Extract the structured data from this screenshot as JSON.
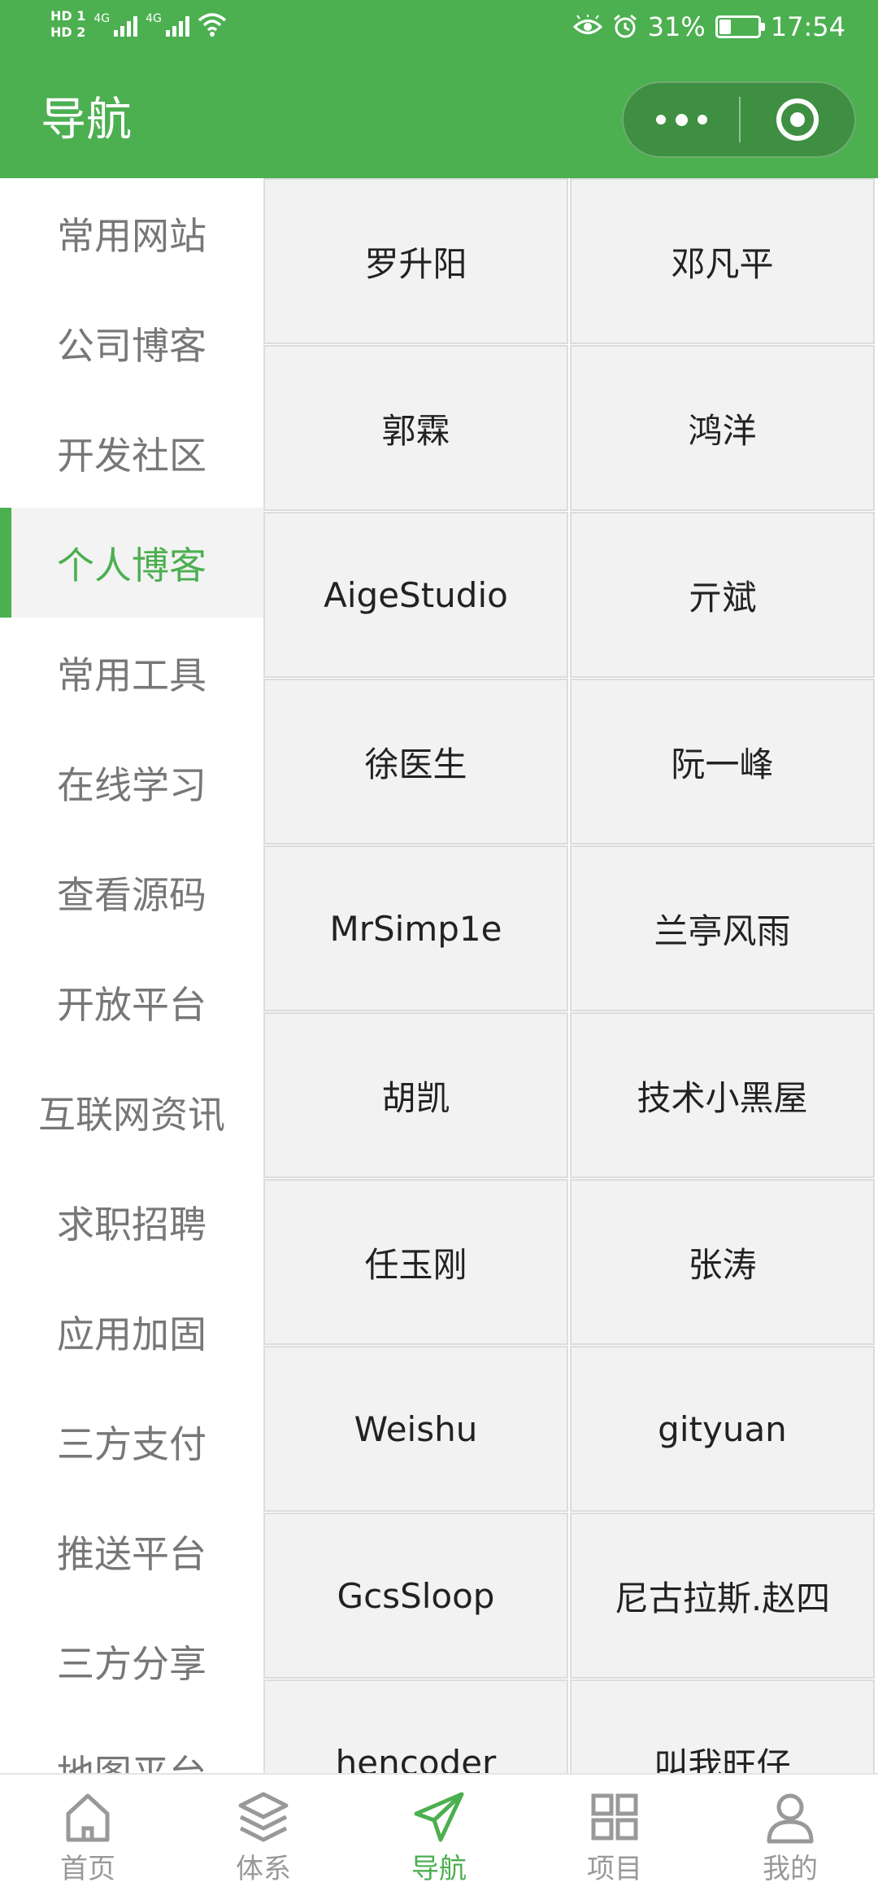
{
  "status_bar": {
    "hd_top": "HD 1",
    "hd_bottom": "HD 2",
    "signal_label": "4G",
    "battery_percent": "31%",
    "time": "17:54",
    "icons": [
      "eye-icon",
      "alarm-icon",
      "battery-icon",
      "wifi-icon",
      "signal-icon"
    ]
  },
  "header": {
    "title": "导航",
    "capsule": {
      "more_icon": "more-dots-icon",
      "close_icon": "target-close-icon"
    }
  },
  "sidebar": {
    "items": [
      {
        "label": "常用网站",
        "active": false
      },
      {
        "label": "公司博客",
        "active": false
      },
      {
        "label": "开发社区",
        "active": false
      },
      {
        "label": "个人博客",
        "active": true
      },
      {
        "label": "常用工具",
        "active": false
      },
      {
        "label": "在线学习",
        "active": false
      },
      {
        "label": "查看源码",
        "active": false
      },
      {
        "label": "开放平台",
        "active": false
      },
      {
        "label": "互联网资讯",
        "active": false
      },
      {
        "label": "求职招聘",
        "active": false
      },
      {
        "label": "应用加固",
        "active": false
      },
      {
        "label": "三方支付",
        "active": false
      },
      {
        "label": "推送平台",
        "active": false
      },
      {
        "label": "三方分享",
        "active": false
      },
      {
        "label": "地图平台",
        "active": false
      }
    ]
  },
  "grid": {
    "items": [
      "罗升阳",
      "邓凡平",
      "郭霖",
      "鸿洋",
      "AigeStudio",
      "亓斌",
      "徐医生",
      "阮一峰",
      "MrSimp1e",
      "兰亭风雨",
      "胡凯",
      "技术小黑屋",
      "任玉刚",
      "张涛",
      "Weishu",
      "gityuan",
      "GcsSloop",
      "尼古拉斯.赵四",
      "hencoder",
      "叫我旺仔"
    ]
  },
  "tabbar": {
    "tabs": [
      {
        "label": "首页",
        "icon": "home-icon",
        "active": false
      },
      {
        "label": "体系",
        "icon": "layers-icon",
        "active": false
      },
      {
        "label": "导航",
        "icon": "send-icon",
        "active": true
      },
      {
        "label": "项目",
        "icon": "grid-icon",
        "active": false
      },
      {
        "label": "我的",
        "icon": "person-icon",
        "active": false
      }
    ]
  },
  "colors": {
    "brand": "#4caf50",
    "inactive_text": "#777777",
    "cell_bg": "#f2f2f2"
  }
}
